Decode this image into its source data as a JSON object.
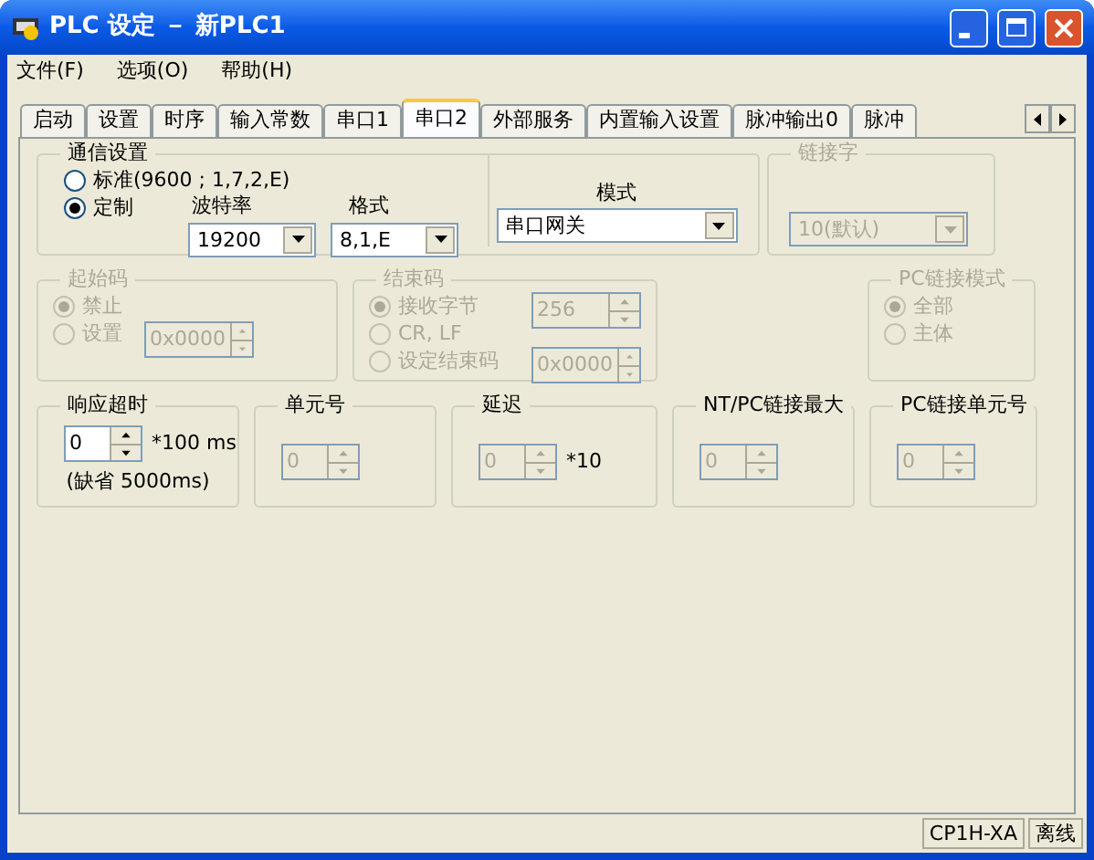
{
  "window": {
    "title": "PLC 设定 － 新PLC1"
  },
  "menu": [
    {
      "label": "文件(F)"
    },
    {
      "label": "选项(O)"
    },
    {
      "label": "帮助(H)"
    }
  ],
  "tabs": [
    {
      "label": "启动",
      "selected": false
    },
    {
      "label": "设置",
      "selected": false
    },
    {
      "label": "时序",
      "selected": false
    },
    {
      "label": "输入常数",
      "selected": false
    },
    {
      "label": "串口1",
      "selected": false
    },
    {
      "label": "串口2",
      "selected": true
    },
    {
      "label": "外部服务",
      "selected": false
    },
    {
      "label": "内置输入设置",
      "selected": false
    },
    {
      "label": "脉冲输出0",
      "selected": false
    },
    {
      "label": "脉冲",
      "selected": false
    }
  ],
  "comm": {
    "title": "通信设置",
    "radios": [
      {
        "label": "标准(9600 ; 1,7,2,E)",
        "selected": false
      },
      {
        "label": "定制",
        "selected": true
      }
    ],
    "baud": {
      "label": "波特率",
      "value": "19200"
    },
    "format": {
      "label": "格式",
      "value": "8,1,E"
    },
    "mode": {
      "label": "模式",
      "value": "串口网关"
    }
  },
  "link_word": {
    "title": "链接字",
    "value": "10(默认)",
    "disabled": true
  },
  "start_code": {
    "title": "起始码",
    "disabled": true,
    "radios": [
      {
        "label": "禁止",
        "selected": true
      },
      {
        "label": "设置",
        "selected": false
      }
    ],
    "value": "0x0000"
  },
  "end_code": {
    "title": "结束码",
    "disabled": true,
    "radios": [
      {
        "label": "接收字节",
        "selected": true
      },
      {
        "label": "CR, LF",
        "selected": false
      },
      {
        "label": "设定结束码",
        "selected": false
      }
    ],
    "bytes": "256",
    "code": "0x0000"
  },
  "pc_link_mode": {
    "title": "PC链接模式",
    "disabled": true,
    "radios": [
      {
        "label": "全部",
        "selected": true
      },
      {
        "label": "主体",
        "selected": false
      }
    ]
  },
  "spinners": [
    {
      "title": "响应超时",
      "value": "0",
      "unit": "*100 ms",
      "note": "(缺省 5000ms)",
      "disabled": false
    },
    {
      "title": "单元号",
      "value": "0",
      "disabled": true
    },
    {
      "title": "延迟",
      "value": "0",
      "unit": "*10",
      "disabled": true
    },
    {
      "title": "NT/PC链接最大",
      "value": "0",
      "disabled": true
    },
    {
      "title": "PC链接单元号",
      "value": "0",
      "disabled": true
    }
  ],
  "status_bar": [
    {
      "text": "CP1H-XA"
    },
    {
      "text": "离线"
    }
  ]
}
